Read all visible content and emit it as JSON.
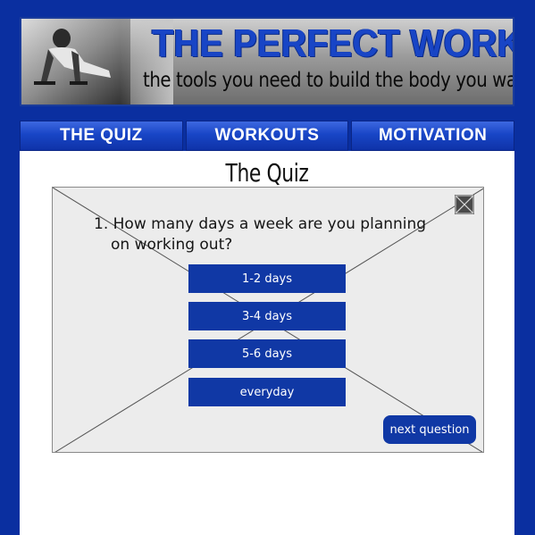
{
  "banner": {
    "title": "THE PERFECT WORKOUT",
    "subtitle": "the tools you need to build the body you want",
    "photo_icon": "pushup-photo"
  },
  "nav": {
    "items": [
      {
        "label": "THE QUIZ"
      },
      {
        "label": "WORKOUTS"
      },
      {
        "label": "MOTIVATION"
      }
    ]
  },
  "page": {
    "title": "The Quiz"
  },
  "quiz": {
    "question_number": "1.",
    "question_line1": "How many days a week are you planning",
    "question_line2": "on working out?",
    "answers": [
      {
        "label": "1-2 days"
      },
      {
        "label": "3-4 days"
      },
      {
        "label": "5-6 days"
      },
      {
        "label": "everyday"
      }
    ],
    "next_label": "next question",
    "close_icon": "close-icon"
  },
  "colors": {
    "background": "#0a2fa0",
    "accent": "#1038a5",
    "panel": "#ececec"
  }
}
